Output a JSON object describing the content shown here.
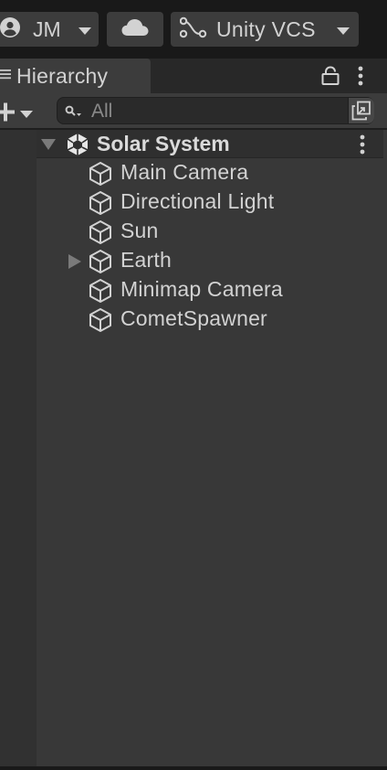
{
  "toolbar_top": {
    "account_label": "JM",
    "vcs_label": "Unity VCS"
  },
  "tab": {
    "title": "Hierarchy"
  },
  "search": {
    "placeholder": "All"
  },
  "scene": {
    "name": "Solar System",
    "expanded": true,
    "items": [
      {
        "label": "Main Camera",
        "has_children": false
      },
      {
        "label": "Directional Light",
        "has_children": false
      },
      {
        "label": "Sun",
        "has_children": false
      },
      {
        "label": "Earth",
        "has_children": true,
        "expanded": false
      },
      {
        "label": "Minimap Camera",
        "has_children": false
      },
      {
        "label": "CometSpawner",
        "has_children": false
      }
    ]
  },
  "colors": {
    "background": "#191919",
    "panel": "#383838",
    "toolbar": "#3c3c3c",
    "text": "#d2d2d2"
  },
  "icons": [
    "account-icon",
    "cloud-icon",
    "branch-icon",
    "hamburger-icon",
    "lock-icon",
    "kebab-icon",
    "plus-icon",
    "search-icon",
    "popout-icon",
    "unity-scene-icon",
    "gameobject-cube-icon",
    "fold-arrow-icon"
  ]
}
